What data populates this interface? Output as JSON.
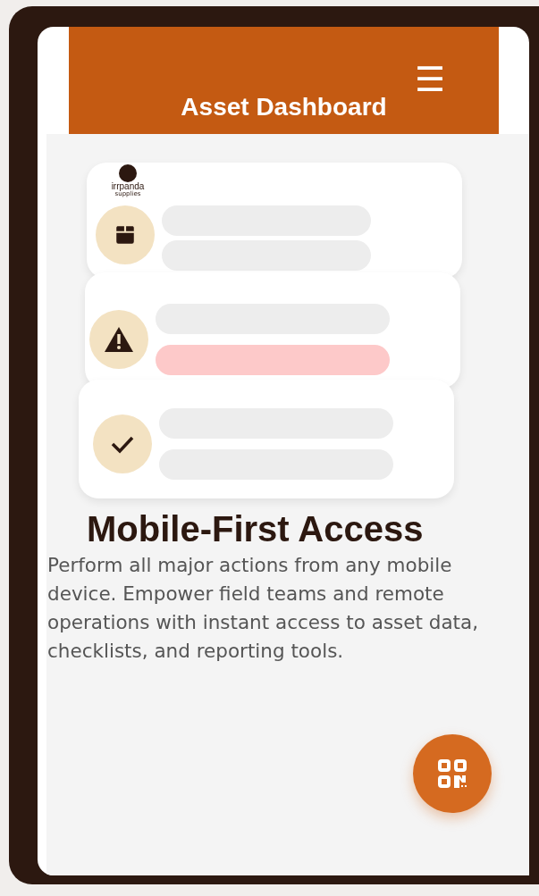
{
  "header": {
    "title": "Asset Dashboard",
    "menu_icon": "☰"
  },
  "logo": {
    "name": "irrpanda",
    "tagline": "supplies"
  },
  "cards": [
    {
      "kind": "box",
      "bars": [
        {
          "kind": "plain"
        },
        {
          "kind": "plain"
        }
      ]
    },
    {
      "kind": "warning",
      "bars": [
        {
          "kind": "plain"
        },
        {
          "kind": "alert"
        }
      ]
    },
    {
      "kind": "check",
      "bars": [
        {
          "kind": "plain"
        },
        {
          "kind": "plain"
        }
      ]
    }
  ],
  "feature": {
    "title": "Mobile-First Access",
    "description": "Perform all major actions from any mobile device. Empower field teams and remote operations with instant access to asset data, checklists, and reporting tools."
  },
  "fab": {
    "kind": "qr"
  }
}
